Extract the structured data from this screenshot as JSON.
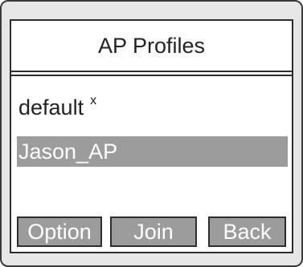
{
  "screen": {
    "title": "AP Profiles"
  },
  "profiles": [
    {
      "label": "default",
      "marker": "x",
      "selected": false
    },
    {
      "label": "Jason_AP",
      "marker": "",
      "selected": true
    }
  ],
  "softkeys": {
    "option": "Option",
    "join": "Join",
    "back": "Back"
  },
  "colors": {
    "selection": "#9c9c9c",
    "border": "#2e2e2e",
    "bezel": "#e6e6e6"
  }
}
